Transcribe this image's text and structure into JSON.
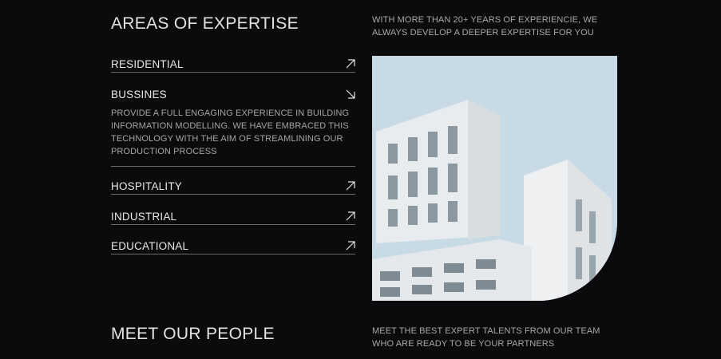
{
  "expertise": {
    "title": "AREAS OF EXPERTISE",
    "tagline": "WITH MORE THAN 20+ YEARS OF EXPERIENCIE, WE ALWAYS DEVELOP A DEEPER EXPERTISE FOR YOU",
    "items": [
      {
        "label": "RESIDENTIAL",
        "arrow": "arrow-up-right-icon"
      },
      {
        "label": "BUSSINES",
        "arrow": "arrow-down-right-icon",
        "expanded": true,
        "description": "PROVIDE A FULL ENGAGING EXPERIENCE IN BUILDING INFORMATION MODELLING. WE HAVE EMBRACED THIS TECHNOLOGY WITH THE AIM OF STREAMLINING OUR PRODUCTION PROCESS"
      },
      {
        "label": "HOSPITALITY",
        "arrow": "arrow-up-right-icon"
      },
      {
        "label": "INDUSTRIAL",
        "arrow": "arrow-up-right-icon"
      },
      {
        "label": "EDUCATIONAL",
        "arrow": "arrow-up-right-icon"
      }
    ]
  },
  "people": {
    "title": "MEET OUR PEOPLE",
    "tagline": "MEET THE BEST EXPERT TALENTS FROM OUR TEAM WHO ARE READY TO BE YOUR PARTNERS"
  },
  "colors": {
    "background": "#0b0b0d",
    "text": "#e6e6e6",
    "muted": "#a8a8a8",
    "divider": "#6a6a6a",
    "sky": "#c9dbe6"
  }
}
